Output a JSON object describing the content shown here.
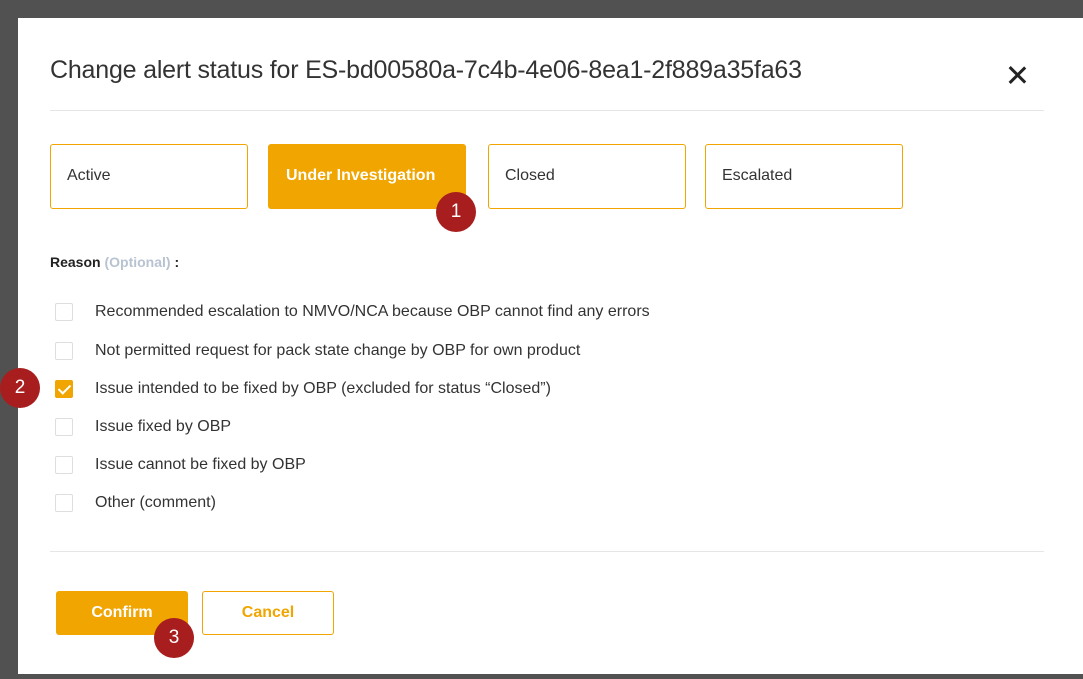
{
  "dialog": {
    "title": "Change alert status for ES-bd00580a-7c4b-4e06-8ea1-2f889a35fa63",
    "close_icon": "close-icon"
  },
  "status_options": [
    {
      "label": "Active",
      "selected": false
    },
    {
      "label": "Under Investigation",
      "selected": true
    },
    {
      "label": "Closed",
      "selected": false
    },
    {
      "label": "Escalated",
      "selected": false
    }
  ],
  "reason": {
    "label": "Reason",
    "optional": "(Optional)",
    "colon": ":",
    "options": [
      {
        "label": "Recommended escalation to NMVO/NCA because OBP cannot find any errors",
        "checked": false
      },
      {
        "label": "Not permitted request for pack state change by OBP for own product",
        "checked": false
      },
      {
        "label": "Issue intended to be fixed by OBP (excluded for status “Closed”)",
        "checked": true
      },
      {
        "label": "Issue fixed by OBP",
        "checked": false
      },
      {
        "label": "Issue cannot be fixed by OBP",
        "checked": false
      },
      {
        "label": "Other (comment)",
        "checked": false
      }
    ]
  },
  "actions": {
    "confirm_label": "Confirm",
    "cancel_label": "Cancel"
  },
  "markers": [
    "1",
    "2",
    "3"
  ],
  "colors": {
    "accent": "#f0a500",
    "marker": "#a81d1d",
    "backdrop": "#515151"
  }
}
